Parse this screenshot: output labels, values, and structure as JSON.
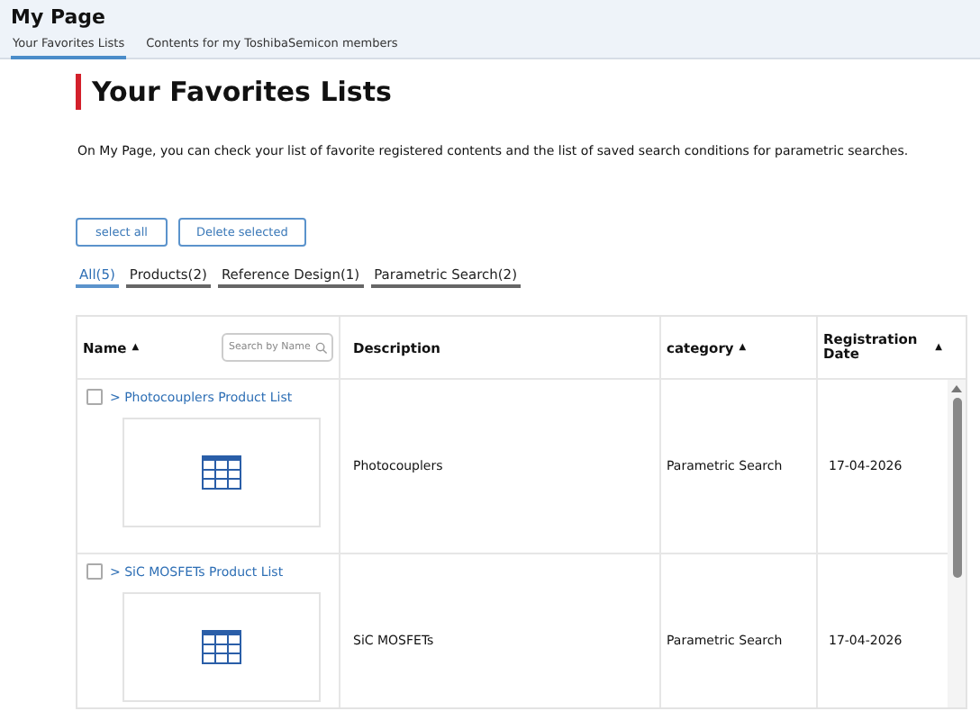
{
  "header": {
    "title": "My Page",
    "tabs": [
      {
        "label": "Your Favorites Lists",
        "selected": true
      },
      {
        "label": "Contents for my ToshibaSemicon members",
        "selected": false
      }
    ]
  },
  "heading": "Your Favorites Lists",
  "intro": "On My Page, you can check your list of favorite registered contents and the list of saved search conditions for parametric searches.",
  "buttons": [
    "select all",
    "Delete selected"
  ],
  "filters": [
    {
      "label": "All(5)",
      "selected": true
    },
    {
      "label": "Products(2)",
      "selected": false
    },
    {
      "label": "Reference Design(1)",
      "selected": false
    },
    {
      "label": "Parametric Search(2)",
      "selected": false
    }
  ],
  "table": {
    "columns": [
      {
        "label": "Name",
        "sort": "▲",
        "search_placeholder": "Search by Name"
      },
      {
        "label": "Description"
      },
      {
        "label": "category",
        "sort": "▲"
      },
      {
        "label": "Registration Date",
        "sort": "▲"
      }
    ],
    "rows": [
      {
        "checked": false,
        "name": "> Photocouplers Product List",
        "description": "Photocouplers",
        "category": "Parametric Search",
        "date": "17-04-2026"
      },
      {
        "checked": false,
        "name": "> SiC MOSFETs Product List",
        "description": "SiC MOSFETs",
        "category": "Parametric Search",
        "date": "17-04-2026"
      }
    ]
  }
}
